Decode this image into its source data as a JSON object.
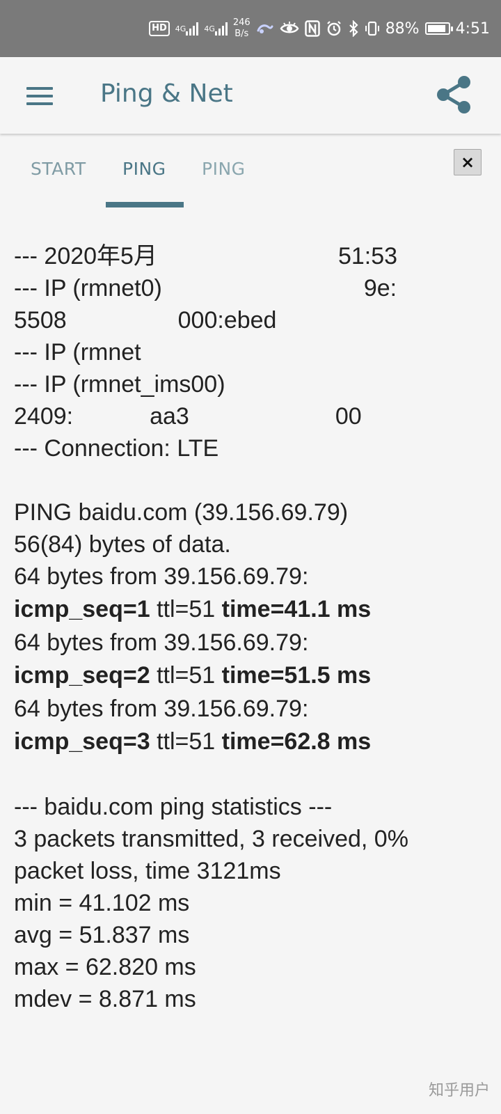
{
  "status_bar": {
    "network_label_1": "4G",
    "network_label_2": "4G",
    "speed_value": "246",
    "speed_unit": "B/s",
    "hd_label": "HD",
    "battery": "88%",
    "time": "4:51",
    "battery_level": 0.88
  },
  "app_bar": {
    "title": "Ping & Net"
  },
  "tabs": [
    {
      "label": "START"
    },
    {
      "label": "PING"
    },
    {
      "label": "PING"
    }
  ],
  "close_label": "×",
  "output": {
    "header_lines": [
      "--- 2020年5月",
      "51:53",
      "--- IP (rmnet0)",
      "9e:",
      "5508",
      "000:ebed",
      "--- IP (rmnet",
      "--- IP (rmnet_ims00)",
      "2409:",
      "aa3",
      "00",
      "--- Connection: LTE"
    ],
    "ping_header": "PING baidu.com (39.156.69.79)",
    "ping_size": "56(84) bytes of data.",
    "replies": [
      {
        "from": "64 bytes from 39.156.69.79:",
        "seq": "icmp_seq=1",
        "ttl": "ttl=51",
        "time": "time=41.1 ms"
      },
      {
        "from": "64 bytes from 39.156.69.79:",
        "seq": "icmp_seq=2",
        "ttl": "ttl=51",
        "time": "time=51.5 ms"
      },
      {
        "from": "64 bytes from 39.156.69.79:",
        "seq": "icmp_seq=3",
        "ttl": "ttl=51",
        "time": "time=62.8 ms"
      }
    ],
    "stats_header": "--- baidu.com ping statistics ---",
    "stats_line1": "3 packets transmitted, 3 received, 0%",
    "stats_line2": "packet loss, time 3121ms",
    "min": "min = 41.102 ms",
    "avg": "avg = 51.837 ms",
    "max": "max = 62.820 ms",
    "mdev": "mdev = 8.871 ms"
  },
  "watermark": "知乎用户",
  "colors": {
    "accent": "#4a7686",
    "status_bar_bg": "#7a7a7a",
    "background": "#f5f5f5"
  }
}
